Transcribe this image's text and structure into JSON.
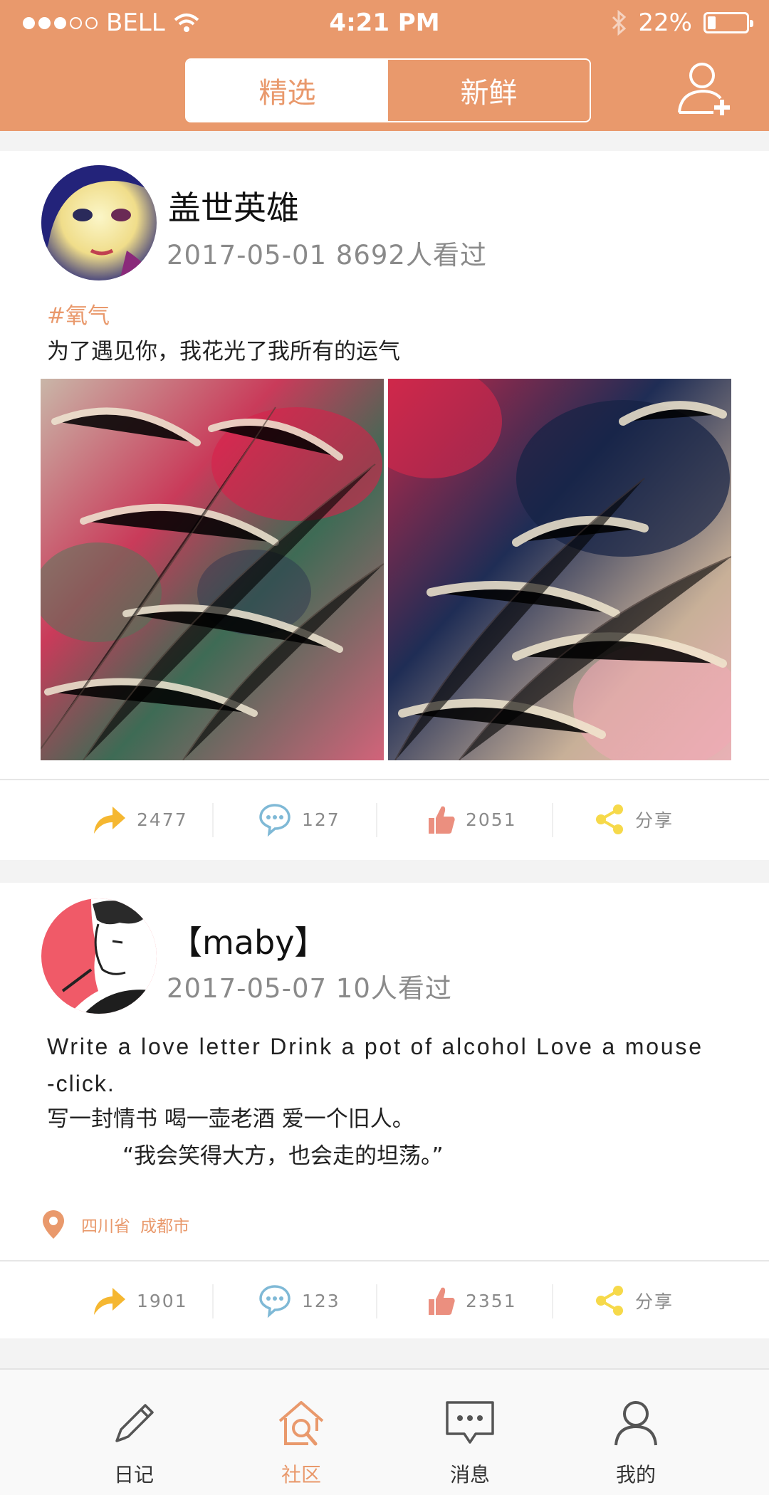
{
  "status_bar": {
    "carrier": "BELL",
    "time": "4:21 PM",
    "battery": "22%",
    "battery_level": 0.22
  },
  "header": {
    "tabs": [
      {
        "label": "精选",
        "active": true
      },
      {
        "label": "新鲜",
        "active": false
      }
    ],
    "add_user_icon": "add-user-icon"
  },
  "posts": [
    {
      "username": "盖世英雄",
      "meta": "2017-05-01 8692人看过",
      "tag": "#氧气",
      "text": "为了遇见你，我花光了我所有的运气",
      "actions": {
        "forward": "2477",
        "comment": "127",
        "like": "2051",
        "share": "分享"
      }
    },
    {
      "username": "【maby】",
      "meta": "2017-05-07 10人看过",
      "lines": [
        "Write a love letter Drink a pot of alcohol Love a mouse",
        "-click.",
        "写一封情书 喝一壶老酒 爱一个旧人。",
        "“我会笑得大方，也会走的坦荡。”"
      ],
      "location": {
        "province": "四川省",
        "city": "成都市"
      },
      "actions": {
        "forward": "1901",
        "comment": "123",
        "like": "2351",
        "share": "分享"
      }
    }
  ],
  "tab_bar": [
    {
      "label": "日记",
      "icon": "pencil-icon",
      "active": false
    },
    {
      "label": "社区",
      "icon": "house-search-icon",
      "active": true
    },
    {
      "label": "消息",
      "icon": "chat-bubble-icon",
      "active": false
    },
    {
      "label": "我的",
      "icon": "person-icon",
      "active": false
    }
  ],
  "colors": {
    "accent": "#e9996c",
    "forward": "#f5b731",
    "comment": "#7fb9d6",
    "like": "#eb8f7f",
    "share": "#f6d94a"
  }
}
